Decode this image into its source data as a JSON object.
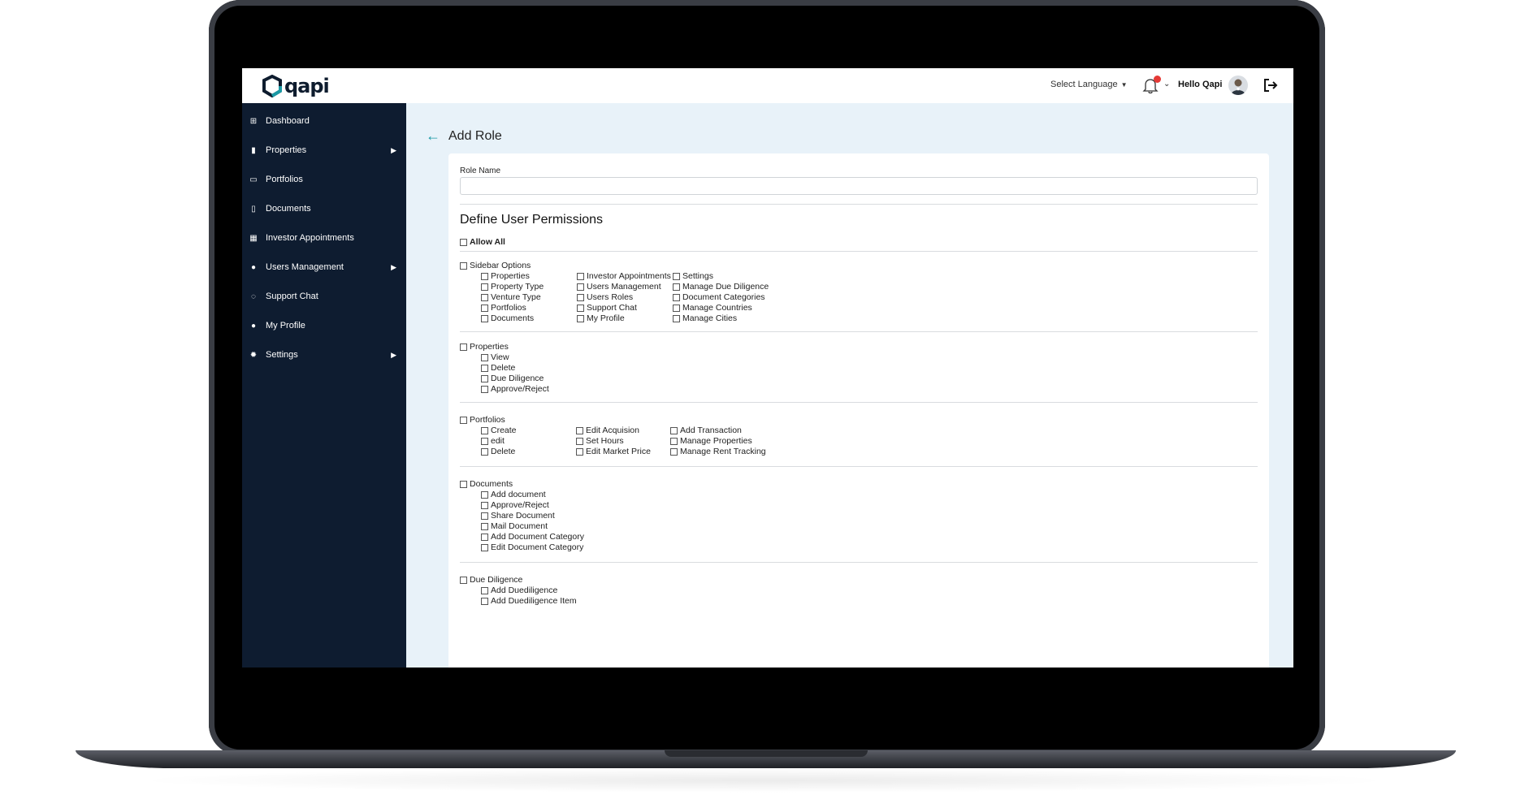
{
  "brand": {
    "logo_text": "qapi"
  },
  "header": {
    "language_label": "Select Language",
    "greeting": "Hello Qapi"
  },
  "sidebar": {
    "items": [
      {
        "label": "Dashboard",
        "icon": "grid-icon",
        "has_arrow": false
      },
      {
        "label": "Properties",
        "icon": "bar-chart-icon",
        "has_arrow": true
      },
      {
        "label": "Portfolios",
        "icon": "folder-icon",
        "has_arrow": false
      },
      {
        "label": "Documents",
        "icon": "document-icon",
        "has_arrow": false
      },
      {
        "label": "Investor Appointments",
        "icon": "calendar-icon",
        "has_arrow": false
      },
      {
        "label": "Users Management",
        "icon": "user-gear-icon",
        "has_arrow": true
      },
      {
        "label": "Support Chat",
        "icon": "chat-icon",
        "has_arrow": false
      },
      {
        "label": "My Profile",
        "icon": "user-icon",
        "has_arrow": false
      },
      {
        "label": "Settings",
        "icon": "gear-icon",
        "has_arrow": true
      }
    ]
  },
  "page": {
    "title": "Add Role",
    "role_name_label": "Role Name",
    "role_name_value": "",
    "permissions_title": "Define User Permissions",
    "allow_all": "Allow All"
  },
  "permissions": {
    "sidebar_options": {
      "label": "Sidebar Options",
      "col1": [
        "Properties",
        "Property Type",
        "Venture Type",
        "Portfolios",
        "Documents"
      ],
      "col2": [
        "Investor Appointments",
        "Users Management",
        "Users Roles",
        "Support Chat",
        "My Profile"
      ],
      "col3": [
        "Settings",
        "Manage Due Diligence",
        "Document Categories",
        "Manage Countries",
        "Manage Cities"
      ]
    },
    "properties": {
      "label": "Properties",
      "col1": [
        "View",
        "Delete",
        "Due Diligence",
        "Approve/Reject"
      ]
    },
    "portfolios": {
      "label": "Portfolios",
      "col1": [
        "Create",
        "edit",
        "Delete"
      ],
      "col2": [
        "Edit Acquision",
        "Set Hours",
        "Edit Market Price"
      ],
      "col3": [
        "Add Transaction",
        "Manage Properties",
        "Manage Rent Tracking"
      ]
    },
    "documents": {
      "label": "Documents",
      "col1": [
        "Add document",
        "Approve/Reject",
        "Share Document",
        "Mail Document",
        "Add Document Category",
        "Edit Document Category"
      ]
    },
    "due_diligence": {
      "label": "Due Diligence",
      "col1": [
        "Add Duediligence",
        "Add Duediligence Item"
      ]
    }
  },
  "colors": {
    "sidebar_bg": "#0e1c30",
    "accent": "#1b9aa5",
    "content_bg": "#e8f2f9",
    "badge": "#e53935"
  }
}
